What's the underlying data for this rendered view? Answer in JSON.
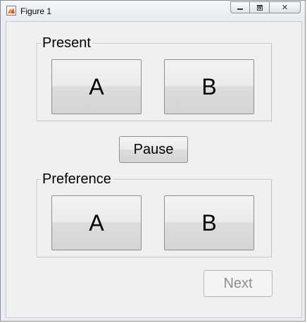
{
  "window": {
    "title": "Figure 1",
    "icon": "matlab-figure-icon",
    "controls": {
      "minimize_icon": "minimize-icon",
      "restore_icon": "restore-icon",
      "close_glyph": "✕"
    }
  },
  "present_panel": {
    "title": "Present",
    "buttons": [
      {
        "label": "A"
      },
      {
        "label": "B"
      }
    ]
  },
  "pause_button": {
    "label": "Pause"
  },
  "preference_panel": {
    "title": "Preference",
    "buttons": [
      {
        "label": "A"
      },
      {
        "label": "B"
      }
    ]
  },
  "next_button": {
    "label": "Next",
    "enabled": false
  },
  "colors": {
    "background": "#f0f0f0",
    "disabled_text": "#8d8d8d"
  }
}
